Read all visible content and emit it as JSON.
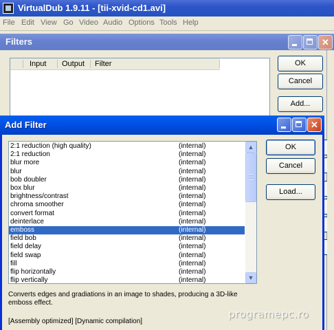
{
  "main_window": {
    "title": "VirtualDub 1.9.11 - [tii-xvid-cd1.avi]",
    "menu": [
      "File",
      "Edit",
      "View",
      "Go",
      "Video",
      "Audio",
      "Options",
      "Tools",
      "Help"
    ]
  },
  "filters_dialog": {
    "title": "Filters",
    "columns": [
      "Input",
      "Output",
      "Filter"
    ],
    "buttons": {
      "ok": "OK",
      "cancel": "Cancel",
      "add": "Add..."
    }
  },
  "add_filter_dialog": {
    "title": "Add Filter",
    "filters": [
      {
        "name": "2:1 reduction (high quality)",
        "source": "(internal)"
      },
      {
        "name": "2:1 reduction",
        "source": "(internal)"
      },
      {
        "name": "blur more",
        "source": "(internal)"
      },
      {
        "name": "blur",
        "source": "(internal)"
      },
      {
        "name": "bob doubler",
        "source": "(internal)"
      },
      {
        "name": "box blur",
        "source": "(internal)"
      },
      {
        "name": "brightness/contrast",
        "source": "(internal)"
      },
      {
        "name": "chroma smoother",
        "source": "(internal)"
      },
      {
        "name": "convert format",
        "source": "(internal)"
      },
      {
        "name": "deinterlace",
        "source": "(internal)"
      },
      {
        "name": "emboss",
        "source": "(internal)"
      },
      {
        "name": "field bob",
        "source": "(internal)"
      },
      {
        "name": "field delay",
        "source": "(internal)"
      },
      {
        "name": "field swap",
        "source": "(internal)"
      },
      {
        "name": "fill",
        "source": "(internal)"
      },
      {
        "name": "flip horizontally",
        "source": "(internal)"
      },
      {
        "name": "flip vertically",
        "source": "(internal)"
      }
    ],
    "selected_filter": "emboss",
    "buttons": {
      "ok": "OK",
      "cancel": "Cancel",
      "load": "Load..."
    },
    "description": "Converts edges and gradiations in an image to shades, producing a 3D-like emboss effect.",
    "flags": "[Assembly optimized] [Dynamic compilation]"
  },
  "watermark": "programepc.ro",
  "colors": {
    "selection": "#316ac5",
    "active_titlebar": "#0054e3",
    "inactive_titlebar": "#7a93dc"
  }
}
